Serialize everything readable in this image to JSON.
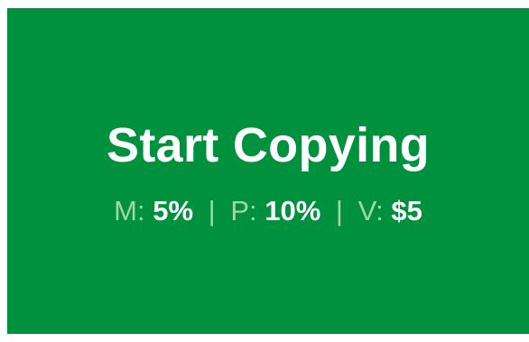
{
  "button": {
    "title": "Start Copying",
    "stats": {
      "m_label": "M:",
      "m_value": "5%",
      "p_label": "P:",
      "p_value": "10%",
      "v_label": "V:",
      "v_value": "$5",
      "separator": "|"
    }
  },
  "colors": {
    "background": "#00913f",
    "title": "#ffffff",
    "label": "#9fd7a7",
    "value": "#ffffff"
  }
}
